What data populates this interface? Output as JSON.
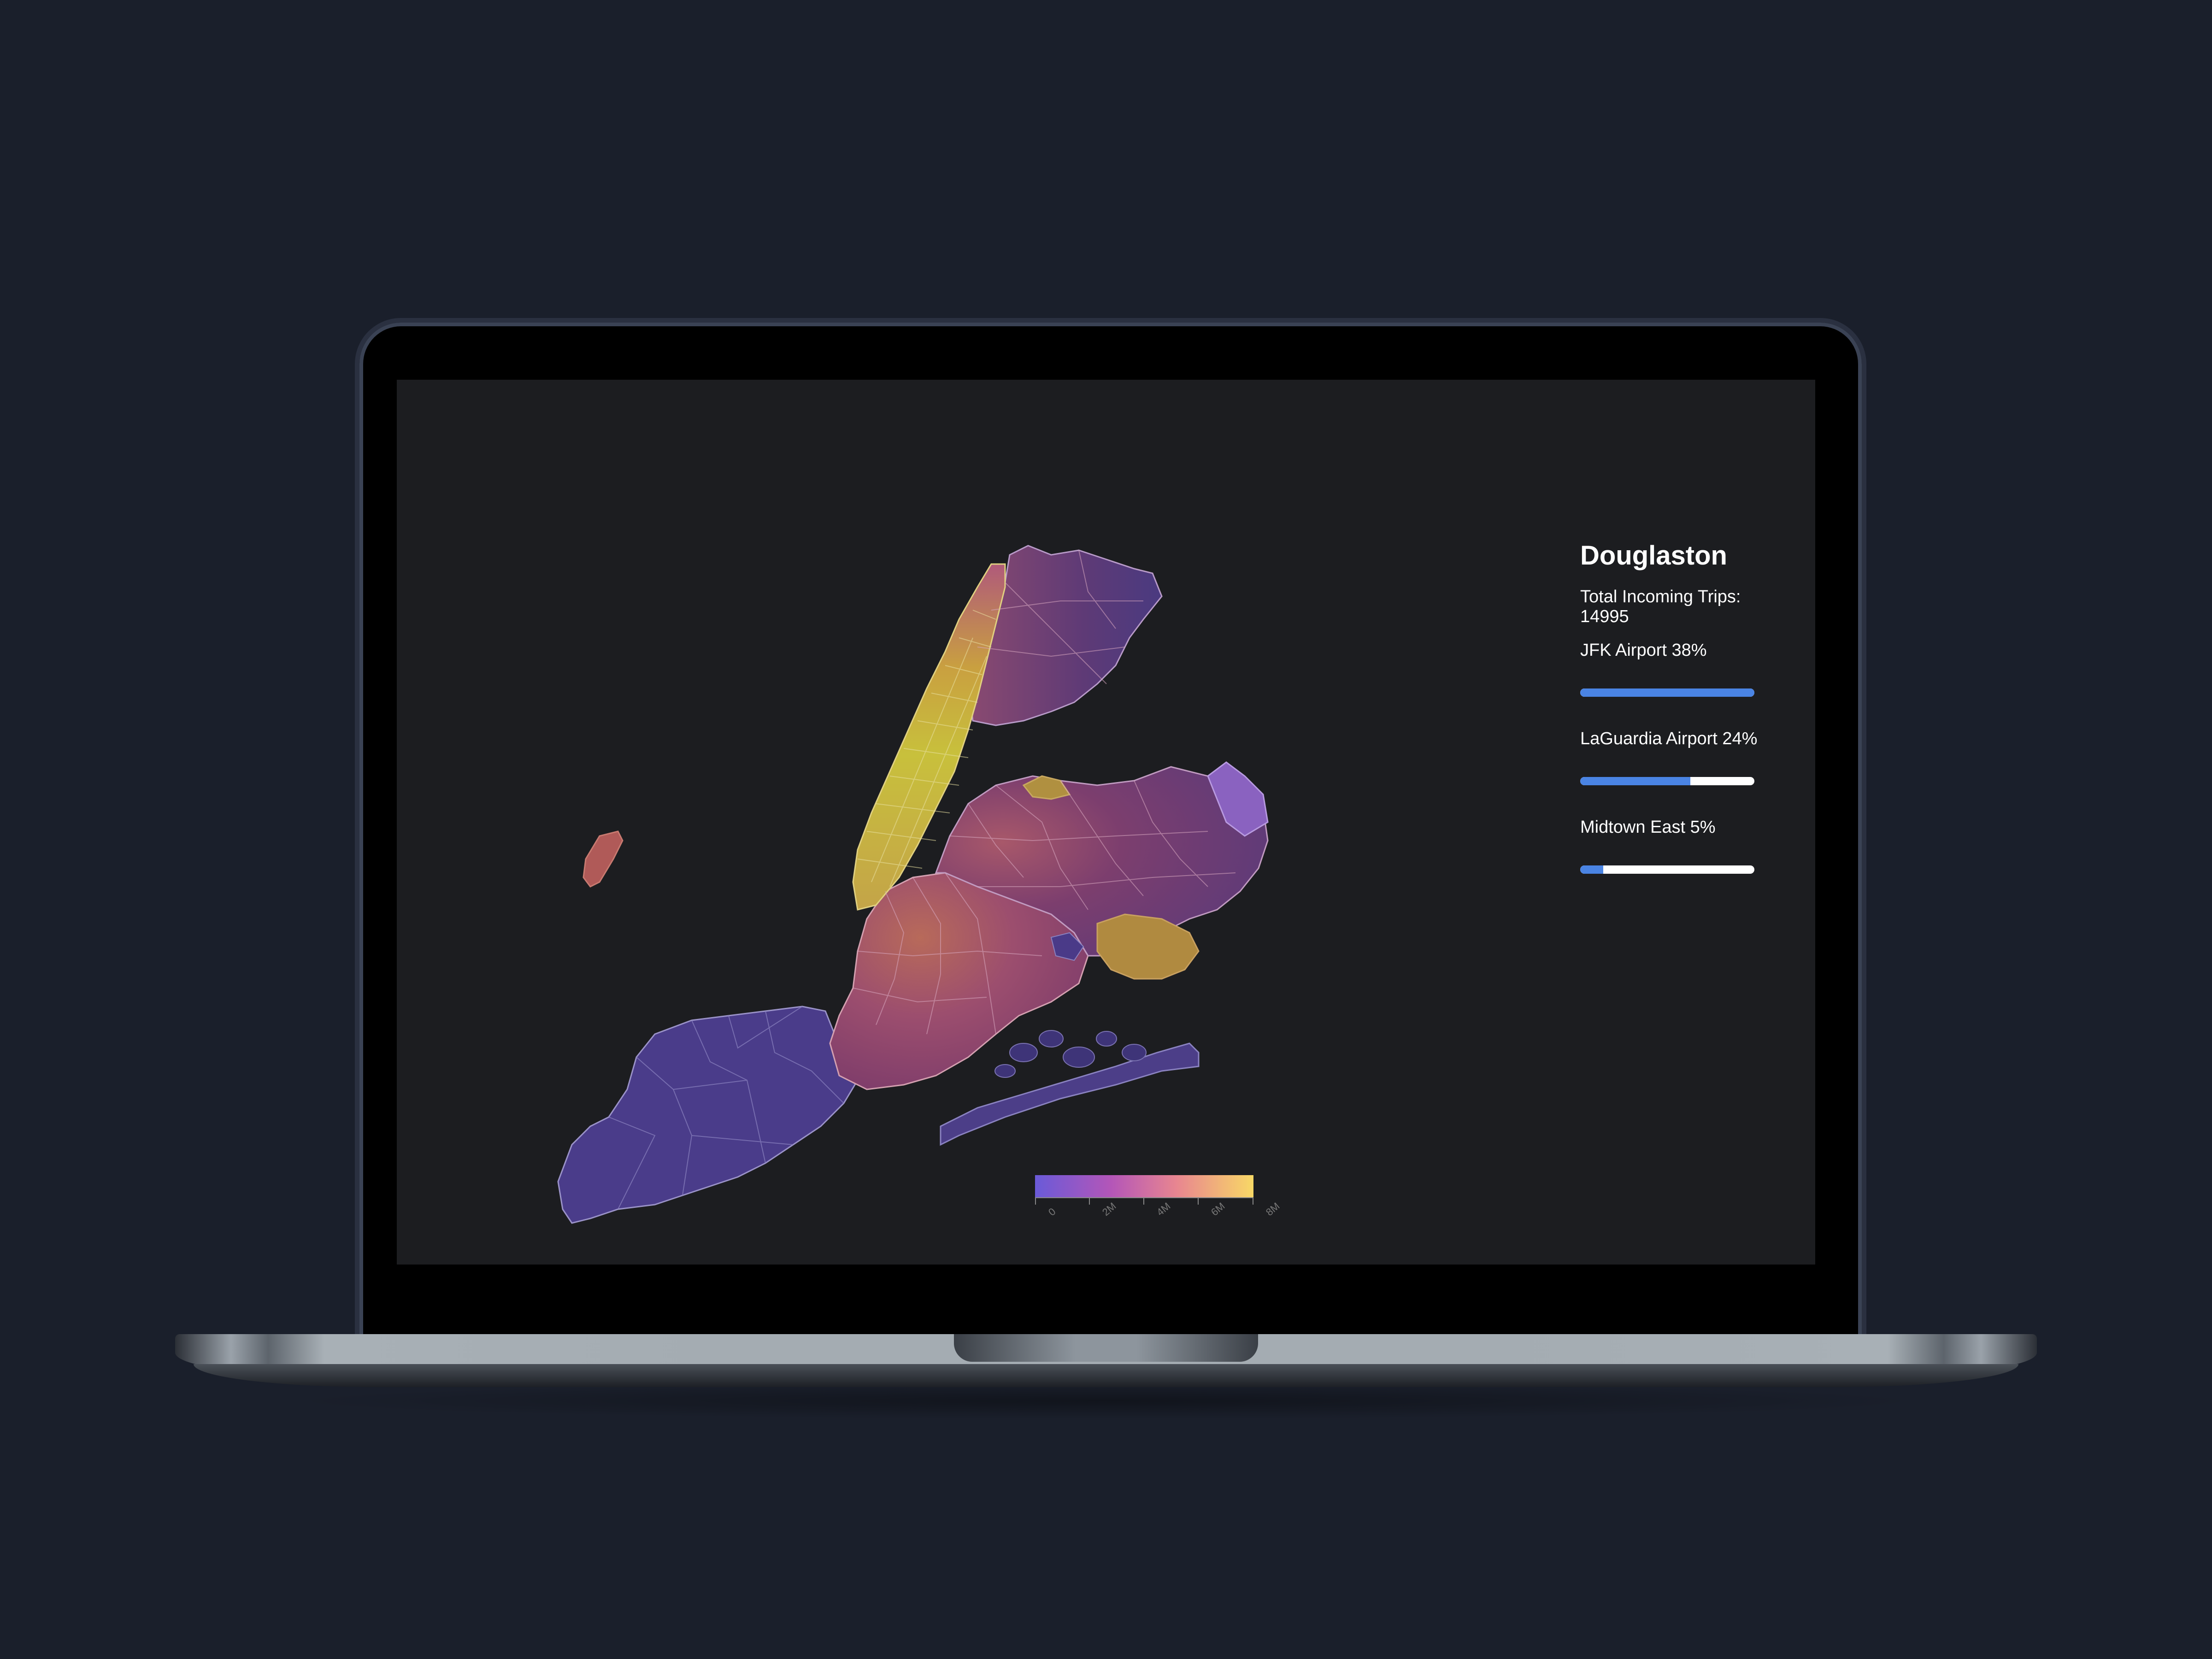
{
  "panel": {
    "title": "Douglaston",
    "total": "Total Incoming Trips: 14995",
    "entries": [
      {
        "label": "JFK Airport 38%",
        "value": 38
      },
      {
        "label": "LaGuardia Airport 24%",
        "value": 24
      },
      {
        "label": "Midtown East 5%",
        "value": 5
      }
    ]
  },
  "legend": {
    "ticks": [
      "0",
      "2M",
      "4M",
      "6M",
      "8M"
    ]
  },
  "colors": {
    "bar_fill": "#4a84e4",
    "bar_track": "#ffffff",
    "background": "#1c1d20"
  }
}
